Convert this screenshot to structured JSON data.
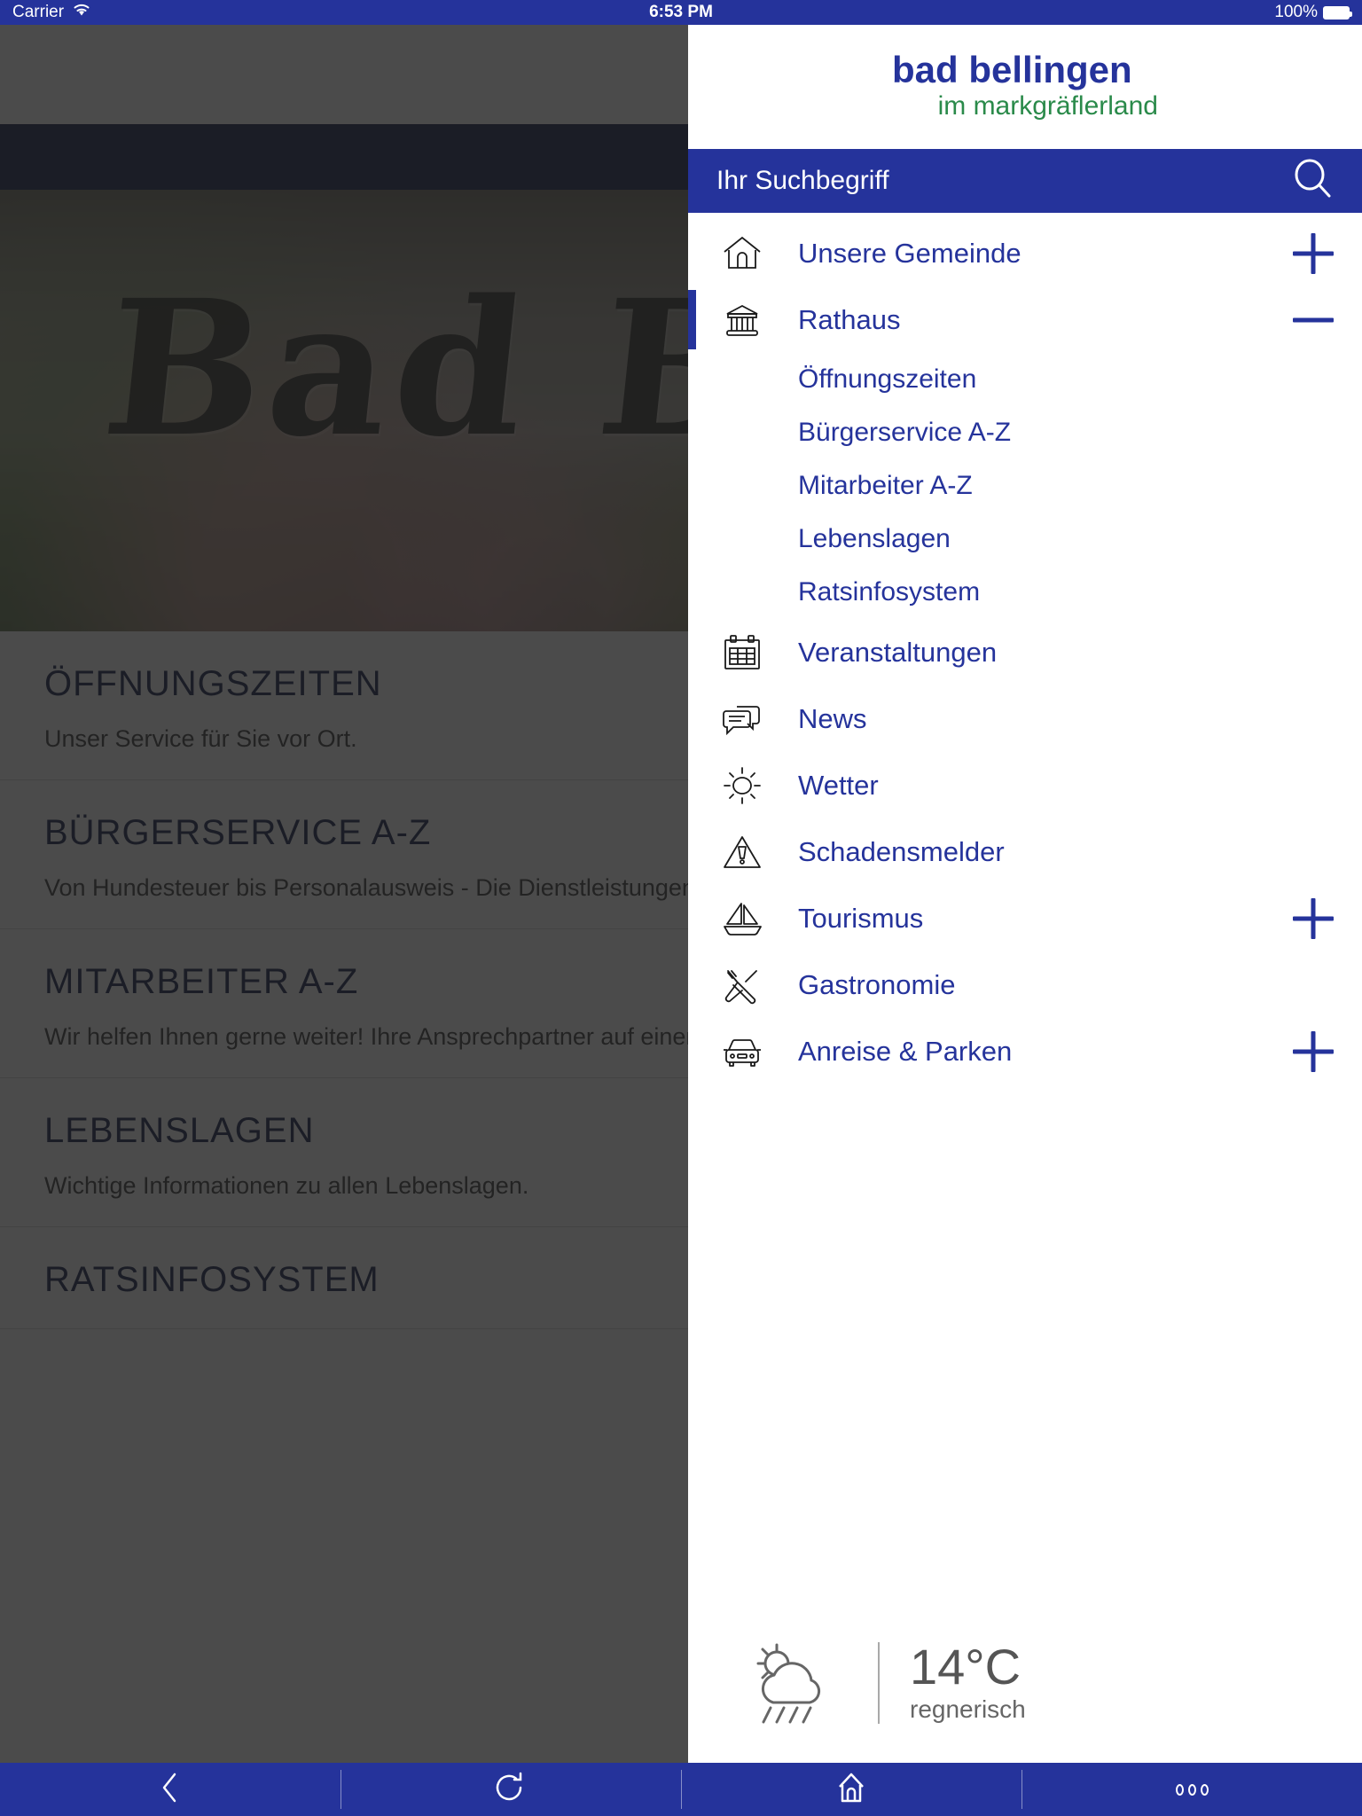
{
  "status_bar": {
    "carrier": "Carrier",
    "wifi_icon": "wifi-icon",
    "time": "6:53 PM",
    "battery_percent": "100%"
  },
  "colors": {
    "accent_blue": "#25339b",
    "dark_navy": "#121c46",
    "green": "#2a8a4a"
  },
  "page": {
    "logo": {
      "main": "bad bellingen",
      "sub": "im markgräflerland"
    },
    "nav_title": "RATHAUS",
    "close_label": "close-icon",
    "hero_text": "Bad Bellin",
    "items": [
      {
        "title": "ÖFFNUNGSZEITEN",
        "desc": "Unser Service für Sie vor Ort."
      },
      {
        "title": "BÜRGERSERVICE A-Z",
        "desc": "Von Hundesteuer bis Personalausweis - Die Dienstleistungen Bad Bellingens von A-Z"
      },
      {
        "title": "MITARBEITER A-Z",
        "desc": "Wir helfen Ihnen gerne weiter! Ihre Ansprechpartner auf einen Blick."
      },
      {
        "title": "LEBENSLAGEN",
        "desc": "Wichtige Informationen zu allen Lebenslagen."
      },
      {
        "title": "RATSINFOSYSTEM",
        "desc": ""
      }
    ]
  },
  "drawer": {
    "logo": {
      "main": "bad bellingen",
      "sub": "im markgräflerland"
    },
    "search": {
      "placeholder": "Ihr Suchbegriff",
      "value": "",
      "icon": "search-icon"
    },
    "menu": [
      {
        "label": "Unsere Gemeinde",
        "icon": "house-icon",
        "toggle": "plus",
        "active": false
      },
      {
        "label": "Rathaus",
        "icon": "bank-icon",
        "toggle": "minus",
        "active": true
      },
      {
        "label": "Öffnungszeiten",
        "sub": true
      },
      {
        "label": "Bürgerservice A-Z",
        "sub": true
      },
      {
        "label": "Mitarbeiter A-Z",
        "sub": true
      },
      {
        "label": "Lebenslagen",
        "sub": true
      },
      {
        "label": "Ratsinfosystem",
        "sub": true
      },
      {
        "label": "Veranstaltungen",
        "icon": "calendar-icon",
        "toggle": "",
        "active": false
      },
      {
        "label": "News",
        "icon": "chat-bubbles-icon",
        "toggle": "",
        "active": false
      },
      {
        "label": "Wetter",
        "icon": "sun-icon",
        "toggle": "",
        "active": false
      },
      {
        "label": "Schadensmelder",
        "icon": "warning-triangle-icon",
        "toggle": "",
        "active": false
      },
      {
        "label": "Tourismus",
        "icon": "sailboat-icon",
        "toggle": "plus",
        "active": false
      },
      {
        "label": "Gastronomie",
        "icon": "cutlery-icon",
        "toggle": "",
        "active": false
      },
      {
        "label": "Anreise & Parken",
        "icon": "car-icon",
        "toggle": "plus",
        "active": false
      }
    ],
    "weather": {
      "icon": "sun-cloud-rain-icon",
      "temperature": "14°C",
      "condition": "regnerisch"
    }
  },
  "toolbar": {
    "buttons": [
      {
        "name": "back-button",
        "icon": "chevron-left-icon"
      },
      {
        "name": "reload-button",
        "icon": "reload-icon"
      },
      {
        "name": "home-button",
        "icon": "home-icon"
      },
      {
        "name": "more-button",
        "icon": "more-dots-icon"
      }
    ]
  }
}
